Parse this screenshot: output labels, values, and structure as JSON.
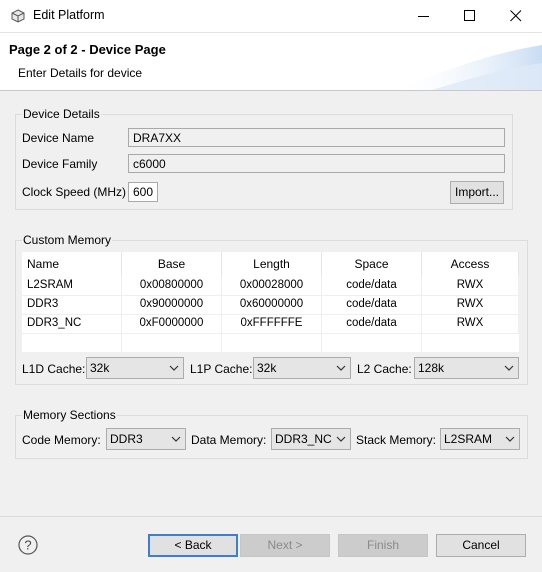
{
  "window": {
    "title": "Edit Platform"
  },
  "banner": {
    "title": "Page 2 of 2 - Device Page",
    "subtitle": "Enter Details for device"
  },
  "device_details": {
    "group_label": "Device Details",
    "name_label": "Device Name",
    "name_value": "DRA7XX",
    "family_label": "Device Family",
    "family_value": "c6000",
    "clock_label": "Clock Speed (MHz)",
    "clock_value": "600",
    "import_label": "Import..."
  },
  "custom_memory": {
    "group_label": "Custom Memory",
    "columns": [
      "Name",
      "Base",
      "Length",
      "Space",
      "Access"
    ],
    "rows": [
      [
        "L2SRAM",
        "0x00800000",
        "0x00028000",
        "code/data",
        "RWX"
      ],
      [
        "DDR3",
        "0x90000000",
        "0x60000000",
        "code/data",
        "RWX"
      ],
      [
        "DDR3_NC",
        "0xF0000000",
        "0xFFFFFFE",
        "code/data",
        "RWX"
      ]
    ],
    "l1d_label": "L1D Cache:",
    "l1d_value": "32k",
    "l1p_label": "L1P Cache:",
    "l1p_value": "32k",
    "l2_label": "L2 Cache:",
    "l2_value": "128k"
  },
  "memory_sections": {
    "group_label": "Memory Sections",
    "code_label": "Code Memory:",
    "code_value": "DDR3",
    "data_label": "Data Memory:",
    "data_value": "DDR3_NC",
    "stack_label": "Stack Memory:",
    "stack_value": "L2SRAM"
  },
  "footer": {
    "help_glyph": "?",
    "back_label": "< Back",
    "next_label": "Next >",
    "finish_label": "Finish",
    "cancel_label": "Cancel"
  },
  "colors": {
    "default_button_border": "#3c7fd1",
    "disabled_text": "#8a8a8a"
  }
}
